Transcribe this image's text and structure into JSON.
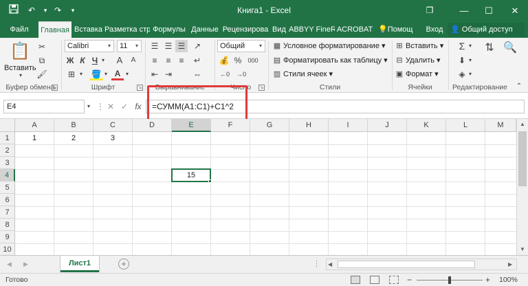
{
  "window": {
    "title": "Книга1 - Excel",
    "controls": {
      "restore": "❐",
      "minimize": "—",
      "maximize": "☐",
      "close": "✕"
    }
  },
  "quick_access": {
    "save_icon": "save-icon",
    "undo_icon": "undo-icon",
    "redo_icon": "redo-icon"
  },
  "tabs": [
    "Файл",
    "Главная",
    "Вставка",
    "Разметка стр",
    "Формулы",
    "Данные",
    "Рецензирова",
    "Вид",
    "ABBYY FineR",
    "ACROBAT",
    "Помощ",
    "Вход"
  ],
  "share_label": "Общий доступ",
  "ribbon": {
    "clipboard": {
      "paste": "Вставить",
      "group": "Буфер обмена"
    },
    "font": {
      "name": "Calibri",
      "size": "11",
      "bold": "Ж",
      "italic": "К",
      "underline": "Ч",
      "grow": "A",
      "shrink": "A",
      "font_color_letter": "A",
      "group": "Шрифт"
    },
    "alignment": {
      "group": "Выравнивание"
    },
    "number": {
      "format": "Общий",
      "percent": "%",
      "thousands": "000",
      "group": "Число"
    },
    "styles": {
      "conditional": "Условное форматирование",
      "as_table": "Форматировать как таблицу",
      "cell_styles": "Стили ячеек",
      "group": "Стили"
    },
    "cells": {
      "insert": "Вставить",
      "delete": "Удалить",
      "format": "Формат",
      "group": "Ячейки"
    },
    "editing": {
      "group": "Редактирование"
    }
  },
  "formula_bar": {
    "name_box": "E4",
    "cancel": "✕",
    "enter": "✓",
    "fx": "fx",
    "formula": "=СУММ(A1:C1)+C1^2"
  },
  "columns": [
    "A",
    "B",
    "C",
    "D",
    "E",
    "F",
    "G",
    "H",
    "I",
    "J",
    "K",
    "L",
    "M"
  ],
  "rows": [
    "1",
    "2",
    "3",
    "4",
    "5",
    "6",
    "7",
    "8",
    "9",
    "10"
  ],
  "cells": {
    "A1": "1",
    "B1": "2",
    "C1": "3",
    "E4": "15"
  },
  "sheet_tab": "Лист1",
  "add_sheet": "+",
  "status": {
    "ready": "Готово",
    "zoom": "100%",
    "zoom_minus": "−",
    "zoom_plus": "+"
  },
  "colors": {
    "excel_green": "#217346",
    "highlight_red": "#e0393a"
  }
}
